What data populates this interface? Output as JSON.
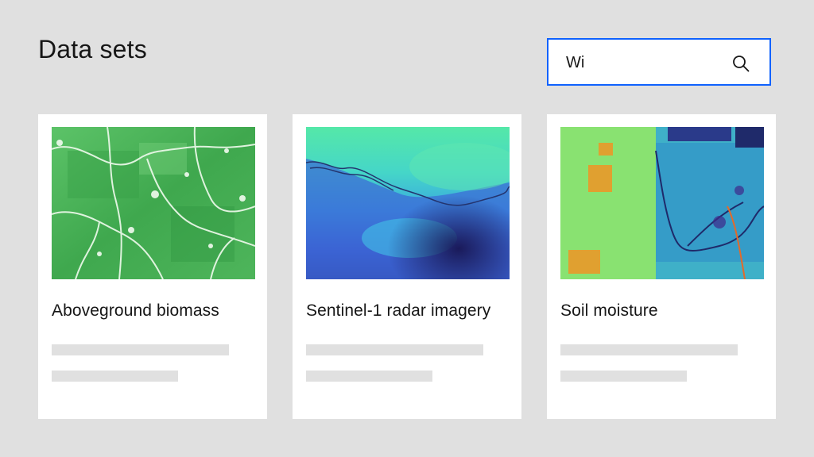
{
  "header": {
    "title": "Data sets"
  },
  "search": {
    "value": "Wi",
    "icon": "search-icon",
    "accent": "#0f62fe"
  },
  "cards": [
    {
      "title": "Aboveground biomass"
    },
    {
      "title": "Sentinel-1 radar imagery"
    },
    {
      "title": "Soil moisture"
    }
  ]
}
